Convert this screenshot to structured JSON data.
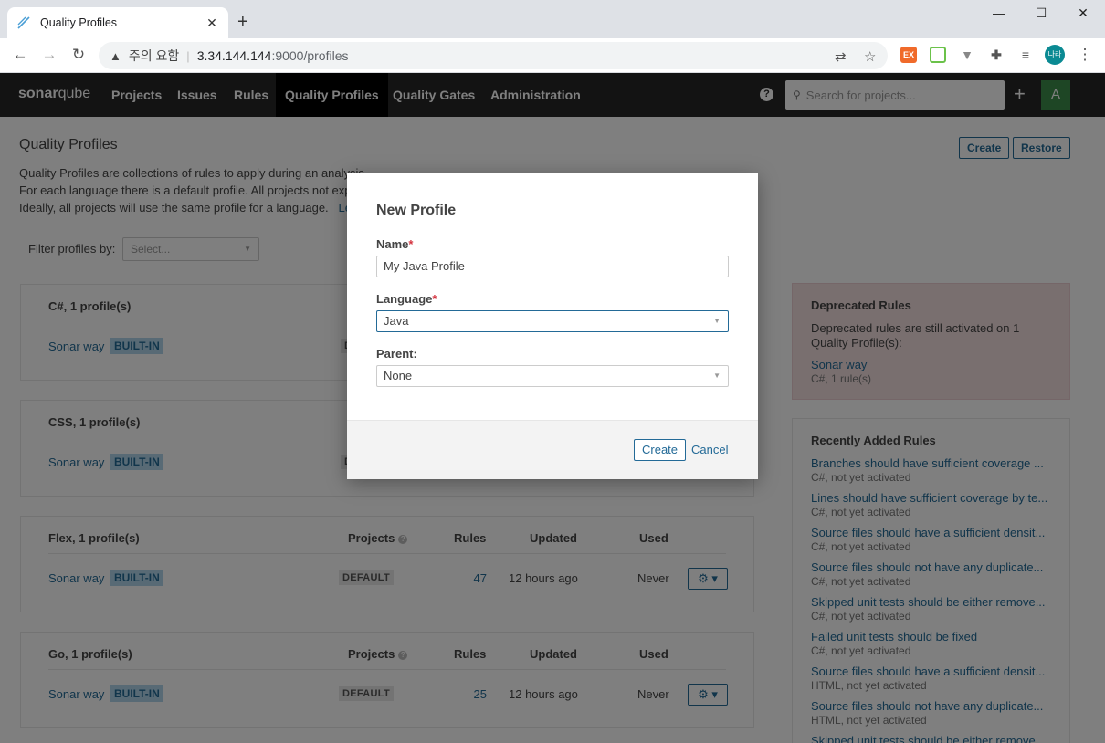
{
  "browser": {
    "tab_title": "Quality Profiles",
    "security_label": "주의 요함",
    "url_host": "3.34.144.144",
    "url_path": ":9000/profiles",
    "profile_initial": "나라"
  },
  "nav": {
    "logo_part1": "sonar",
    "logo_part2": "qube",
    "items": [
      "Projects",
      "Issues",
      "Rules",
      "Quality Profiles",
      "Quality Gates",
      "Administration"
    ],
    "active": "Quality Profiles",
    "search_placeholder": "Search for projects...",
    "avatar": "A"
  },
  "page": {
    "title": "Quality Profiles",
    "desc_line1": "Quality Profiles are collections of rules to apply during an analysis.",
    "desc_line2": "For each language there is a default profile. All projects not exp",
    "desc_line3": "Ideally, all projects will use the same profile for a language.",
    "desc_link": "Le",
    "create_label": "Create",
    "restore_label": "Restore",
    "filter_label": "Filter profiles by:",
    "filter_placeholder": "Select..."
  },
  "cards": [
    {
      "title": "C#, 1 profile(s)",
      "profile": "Sonar way",
      "badge": "BUILT-IN",
      "default_badge": "D"
    },
    {
      "title": "CSS, 1 profile(s)",
      "profile": "Sonar way",
      "badge": "BUILT-IN",
      "default_badge": "D"
    },
    {
      "title": "Flex, 1 profile(s)",
      "profile": "Sonar way",
      "badge": "BUILT-IN",
      "default_badge": "DEFAULT",
      "rules": "47",
      "updated": "12 hours ago",
      "used": "Never"
    },
    {
      "title": "Go, 1 profile(s)",
      "profile": "Sonar way",
      "badge": "BUILT-IN",
      "default_badge": "DEFAULT",
      "rules": "25",
      "updated": "12 hours ago",
      "used": "Never"
    }
  ],
  "columns": {
    "projects": "Projects",
    "rules": "Rules",
    "updated": "Updated",
    "used": "Used"
  },
  "deprecated": {
    "title": "Deprecated Rules",
    "text": "Deprecated rules are still activated on 1 Quality Profile(s):",
    "link": "Sonar way",
    "sub": "C#, 1 rule(s)"
  },
  "recent": {
    "title": "Recently Added Rules",
    "items": [
      {
        "name": "Branches should have sufficient coverage ...",
        "sub": "C#, not yet activated"
      },
      {
        "name": "Lines should have sufficient coverage by te...",
        "sub": "C#, not yet activated"
      },
      {
        "name": "Source files should have a sufficient densit...",
        "sub": "C#, not yet activated"
      },
      {
        "name": "Source files should not have any duplicate...",
        "sub": "C#, not yet activated"
      },
      {
        "name": "Skipped unit tests should be either remove...",
        "sub": "C#, not yet activated"
      },
      {
        "name": "Failed unit tests should be fixed",
        "sub": "C#, not yet activated"
      },
      {
        "name": "Source files should have a sufficient densit...",
        "sub": "HTML, not yet activated"
      },
      {
        "name": "Source files should not have any duplicate...",
        "sub": "HTML, not yet activated"
      },
      {
        "name": "Skipped unit tests should be either remove...",
        "sub": ""
      }
    ]
  },
  "modal": {
    "title": "New Profile",
    "name_label": "Name",
    "name_value": "My Java Profile",
    "language_label": "Language",
    "language_value": "Java",
    "parent_label": "Parent:",
    "parent_value": "None",
    "required_mark": "*",
    "create_label": "Create",
    "cancel_label": "Cancel"
  }
}
